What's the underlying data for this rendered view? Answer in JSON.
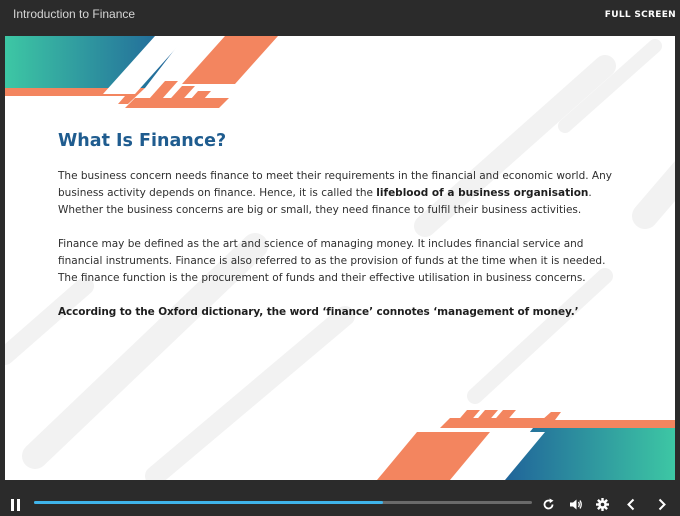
{
  "header": {
    "course_title": "Introduction to Finance",
    "fullscreen_label": "FULL SCREEN"
  },
  "slide": {
    "heading": "What Is Finance?",
    "para1": {
      "before": "The business concern needs finance to meet their requirements in the financial and economic world. Any business activity depends on finance. Hence, it is called the ",
      "bold": "lifeblood of a business organisation",
      "after": ". Whether the business concerns are big or small, they need finance to fulfil their business activities."
    },
    "para2": "Finance may be defined as the art and science of managing money. It includes financial service and financial instruments. Finance is also referred to as the provision of funds at the time when it is needed. The finance function is the procurement of funds and their effective utilisation in business concerns.",
    "para3": "According to the Oxford dictionary, the word ‘finance’ connotes ‘management of money.’"
  },
  "controls": {
    "progress": 0.7,
    "icons": [
      "pause-icon",
      "replay-icon",
      "volume-icon",
      "settings-icon",
      "previous-icon",
      "next-icon"
    ]
  },
  "colors": {
    "accent_orange": "#f3855f",
    "teal": "#3dc7a4",
    "blue": "#1e5d99",
    "heading_blue": "#1f5c8f",
    "progress_blue": "#3fb4ea",
    "chrome": "#2b2b2b"
  }
}
